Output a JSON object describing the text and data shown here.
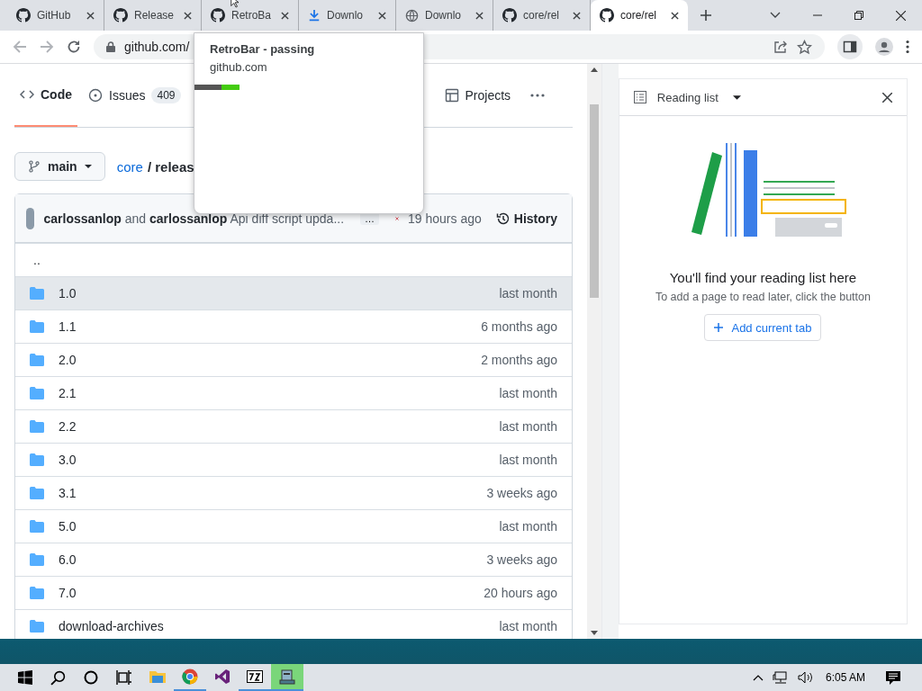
{
  "tabs": [
    {
      "title": "GitHub",
      "kind": "github",
      "selected": false
    },
    {
      "title": "Release",
      "kind": "github",
      "selected": false
    },
    {
      "title": "RetroBa",
      "kind": "github",
      "selected": false
    },
    {
      "title": "Downlo",
      "kind": "download",
      "selected": false
    },
    {
      "title": "Downlo",
      "kind": "globe",
      "selected": false
    },
    {
      "title": "core/rel",
      "kind": "github",
      "selected": false
    },
    {
      "title": "core/rel",
      "kind": "github",
      "selected": true
    }
  ],
  "address": {
    "url": "github.com/"
  },
  "hover_card": {
    "title": "RetroBar - passing",
    "domain": "github.com"
  },
  "repo_nav": [
    {
      "label": "Code",
      "selected": true
    },
    {
      "label": "Issues",
      "count": "409",
      "selected": false
    },
    {
      "label": "Projects",
      "selected": false
    }
  ],
  "branch": {
    "name": "main"
  },
  "breadcrumb": {
    "repo": "core",
    "path": "/ releas"
  },
  "commit": {
    "author": "carlossanlop",
    "joiner": "and",
    "coauthor": "carlossanlop",
    "message": "Api diff script upda...",
    "ellipsis": "…",
    "time": "19 hours ago",
    "history": "History"
  },
  "files": [
    {
      "name": "..",
      "kind": "parent",
      "hovered": false
    },
    {
      "name": "1.0",
      "time": "last month",
      "kind": "folder",
      "hovered": true
    },
    {
      "name": "1.1",
      "time": "6 months ago",
      "kind": "folder",
      "hovered": false
    },
    {
      "name": "2.0",
      "time": "2 months ago",
      "kind": "folder",
      "hovered": false
    },
    {
      "name": "2.1",
      "time": "last month",
      "kind": "folder",
      "hovered": false
    },
    {
      "name": "2.2",
      "time": "last month",
      "kind": "folder",
      "hovered": false
    },
    {
      "name": "3.0",
      "time": "last month",
      "kind": "folder",
      "hovered": false
    },
    {
      "name": "3.1",
      "time": "3 weeks ago",
      "kind": "folder",
      "hovered": false
    },
    {
      "name": "5.0",
      "time": "last month",
      "kind": "folder",
      "hovered": false
    },
    {
      "name": "6.0",
      "time": "3 weeks ago",
      "kind": "folder",
      "hovered": false
    },
    {
      "name": "7.0",
      "time": "20 hours ago",
      "kind": "folder",
      "hovered": false
    },
    {
      "name": "download-archives",
      "time": "last month",
      "kind": "folder",
      "hovered": false
    }
  ],
  "reading_list": {
    "title": "Reading list",
    "heading": "You'll find your reading list here",
    "hint": "To add a page to read later, click the button",
    "button": "Add current tab"
  },
  "taskbar": {
    "apps": [
      {
        "kind": "explorer",
        "active": false
      },
      {
        "kind": "chrome",
        "active": true
      },
      {
        "kind": "vs",
        "active": false
      },
      {
        "kind": "archive",
        "active": true
      },
      {
        "kind": "retrobar",
        "active": true
      }
    ],
    "time": "6:05 AM"
  }
}
